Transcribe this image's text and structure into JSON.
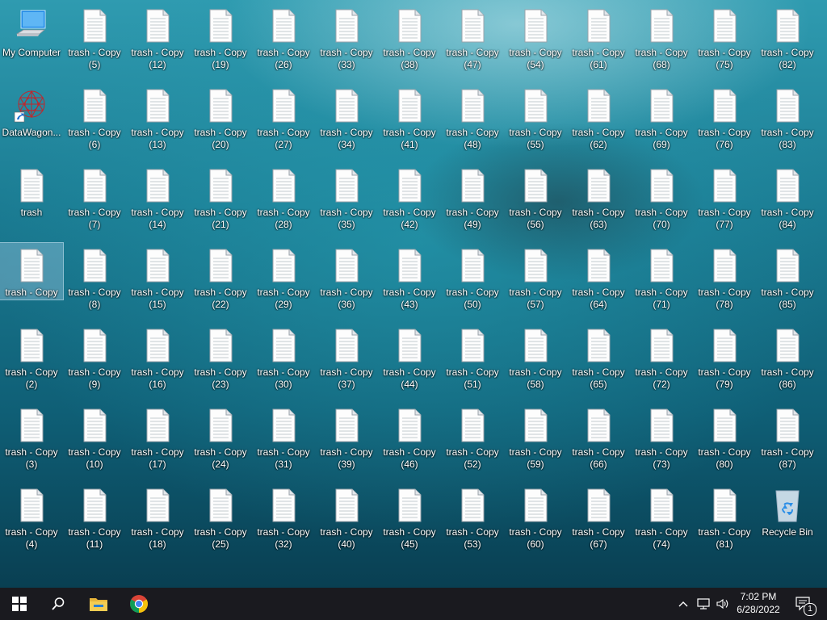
{
  "desktop": {
    "icons": [
      {
        "name": "my-computer-icon",
        "type": "computer",
        "label": "My Computer",
        "sub": "",
        "col": 0,
        "row": 0
      },
      {
        "name": "datawagon-shortcut-icon",
        "type": "app",
        "label": "DataWagon...",
        "sub": "",
        "col": 0,
        "row": 1
      },
      {
        "name": "file-icon",
        "type": "file",
        "label": "trash",
        "sub": "",
        "col": 0,
        "row": 2
      },
      {
        "name": "file-icon",
        "type": "file",
        "label": "trash - Copy",
        "sub": "",
        "col": 0,
        "row": 3,
        "selected": true
      },
      {
        "name": "file-icon",
        "type": "file",
        "label": "trash - Copy",
        "sub": "(2)",
        "col": 0,
        "row": 4
      },
      {
        "name": "file-icon",
        "type": "file",
        "label": "trash - Copy",
        "sub": "(3)",
        "col": 0,
        "row": 5
      },
      {
        "name": "file-icon",
        "type": "file",
        "label": "trash - Copy",
        "sub": "(4)",
        "col": 0,
        "row": 6
      },
      {
        "name": "file-icon",
        "type": "file",
        "label": "trash - Copy",
        "sub": "(5)",
        "col": 1,
        "row": 0
      },
      {
        "name": "file-icon",
        "type": "file",
        "label": "trash - Copy",
        "sub": "(6)",
        "col": 1,
        "row": 1
      },
      {
        "name": "file-icon",
        "type": "file",
        "label": "trash - Copy",
        "sub": "(7)",
        "col": 1,
        "row": 2
      },
      {
        "name": "file-icon",
        "type": "file",
        "label": "trash - Copy",
        "sub": "(8)",
        "col": 1,
        "row": 3
      },
      {
        "name": "file-icon",
        "type": "file",
        "label": "trash - Copy",
        "sub": "(9)",
        "col": 1,
        "row": 4
      },
      {
        "name": "file-icon",
        "type": "file",
        "label": "trash - Copy",
        "sub": "(10)",
        "col": 1,
        "row": 5
      },
      {
        "name": "file-icon",
        "type": "file",
        "label": "trash - Copy",
        "sub": "(11)",
        "col": 1,
        "row": 6
      },
      {
        "name": "file-icon",
        "type": "file",
        "label": "trash - Copy",
        "sub": "(12)",
        "col": 2,
        "row": 0
      },
      {
        "name": "file-icon",
        "type": "file",
        "label": "trash - Copy",
        "sub": "(13)",
        "col": 2,
        "row": 1
      },
      {
        "name": "file-icon",
        "type": "file",
        "label": "trash - Copy",
        "sub": "(14)",
        "col": 2,
        "row": 2
      },
      {
        "name": "file-icon",
        "type": "file",
        "label": "trash - Copy",
        "sub": "(15)",
        "col": 2,
        "row": 3
      },
      {
        "name": "file-icon",
        "type": "file",
        "label": "trash - Copy",
        "sub": "(16)",
        "col": 2,
        "row": 4
      },
      {
        "name": "file-icon",
        "type": "file",
        "label": "trash - Copy",
        "sub": "(17)",
        "col": 2,
        "row": 5
      },
      {
        "name": "file-icon",
        "type": "file",
        "label": "trash - Copy",
        "sub": "(18)",
        "col": 2,
        "row": 6
      },
      {
        "name": "file-icon",
        "type": "file",
        "label": "trash - Copy",
        "sub": "(19)",
        "col": 3,
        "row": 0
      },
      {
        "name": "file-icon",
        "type": "file",
        "label": "trash - Copy",
        "sub": "(20)",
        "col": 3,
        "row": 1
      },
      {
        "name": "file-icon",
        "type": "file",
        "label": "trash - Copy",
        "sub": "(21)",
        "col": 3,
        "row": 2
      },
      {
        "name": "file-icon",
        "type": "file",
        "label": "trash - Copy",
        "sub": "(22)",
        "col": 3,
        "row": 3
      },
      {
        "name": "file-icon",
        "type": "file",
        "label": "trash - Copy",
        "sub": "(23)",
        "col": 3,
        "row": 4
      },
      {
        "name": "file-icon",
        "type": "file",
        "label": "trash - Copy",
        "sub": "(24)",
        "col": 3,
        "row": 5
      },
      {
        "name": "file-icon",
        "type": "file",
        "label": "trash - Copy",
        "sub": "(25)",
        "col": 3,
        "row": 6
      },
      {
        "name": "file-icon",
        "type": "file",
        "label": "trash - Copy",
        "sub": "(26)",
        "col": 4,
        "row": 0
      },
      {
        "name": "file-icon",
        "type": "file",
        "label": "trash - Copy",
        "sub": "(27)",
        "col": 4,
        "row": 1
      },
      {
        "name": "file-icon",
        "type": "file",
        "label": "trash - Copy",
        "sub": "(28)",
        "col": 4,
        "row": 2
      },
      {
        "name": "file-icon",
        "type": "file",
        "label": "trash - Copy",
        "sub": "(29)",
        "col": 4,
        "row": 3
      },
      {
        "name": "file-icon",
        "type": "file",
        "label": "trash - Copy",
        "sub": "(30)",
        "col": 4,
        "row": 4
      },
      {
        "name": "file-icon",
        "type": "file",
        "label": "trash - Copy",
        "sub": "(31)",
        "col": 4,
        "row": 5
      },
      {
        "name": "file-icon",
        "type": "file",
        "label": "trash - Copy",
        "sub": "(32)",
        "col": 4,
        "row": 6
      },
      {
        "name": "file-icon",
        "type": "file",
        "label": "trash - Copy",
        "sub": "(33)",
        "col": 5,
        "row": 0
      },
      {
        "name": "file-icon",
        "type": "file",
        "label": "trash - Copy",
        "sub": "(34)",
        "col": 5,
        "row": 1
      },
      {
        "name": "file-icon",
        "type": "file",
        "label": "trash - Copy",
        "sub": "(35)",
        "col": 5,
        "row": 2
      },
      {
        "name": "file-icon",
        "type": "file",
        "label": "trash - Copy",
        "sub": "(36)",
        "col": 5,
        "row": 3
      },
      {
        "name": "file-icon",
        "type": "file",
        "label": "trash - Copy",
        "sub": "(37)",
        "col": 5,
        "row": 4
      },
      {
        "name": "file-icon",
        "type": "file",
        "label": "trash - Copy",
        "sub": "(39)",
        "col": 5,
        "row": 5
      },
      {
        "name": "file-icon",
        "type": "file",
        "label": "trash - Copy",
        "sub": "(40)",
        "col": 5,
        "row": 6
      },
      {
        "name": "file-icon",
        "type": "file",
        "label": "trash - Copy",
        "sub": "(38)",
        "col": 6,
        "row": 0
      },
      {
        "name": "file-icon",
        "type": "file",
        "label": "trash - Copy",
        "sub": "(41)",
        "col": 6,
        "row": 1
      },
      {
        "name": "file-icon",
        "type": "file",
        "label": "trash - Copy",
        "sub": "(42)",
        "col": 6,
        "row": 2
      },
      {
        "name": "file-icon",
        "type": "file",
        "label": "trash - Copy",
        "sub": "(43)",
        "col": 6,
        "row": 3
      },
      {
        "name": "file-icon",
        "type": "file",
        "label": "trash - Copy",
        "sub": "(44)",
        "col": 6,
        "row": 4
      },
      {
        "name": "file-icon",
        "type": "file",
        "label": "trash - Copy",
        "sub": "(46)",
        "col": 6,
        "row": 5
      },
      {
        "name": "file-icon",
        "type": "file",
        "label": "trash - Copy",
        "sub": "(45)",
        "col": 6,
        "row": 6
      },
      {
        "name": "file-icon",
        "type": "file",
        "label": "trash - Copy",
        "sub": "(47)",
        "col": 7,
        "row": 0
      },
      {
        "name": "file-icon",
        "type": "file",
        "label": "trash - Copy",
        "sub": "(48)",
        "col": 7,
        "row": 1
      },
      {
        "name": "file-icon",
        "type": "file",
        "label": "trash - Copy",
        "sub": "(49)",
        "col": 7,
        "row": 2
      },
      {
        "name": "file-icon",
        "type": "file",
        "label": "trash - Copy",
        "sub": "(50)",
        "col": 7,
        "row": 3
      },
      {
        "name": "file-icon",
        "type": "file",
        "label": "trash - Copy",
        "sub": "(51)",
        "col": 7,
        "row": 4
      },
      {
        "name": "file-icon",
        "type": "file",
        "label": "trash - Copy",
        "sub": "(52)",
        "col": 7,
        "row": 5
      },
      {
        "name": "file-icon",
        "type": "file",
        "label": "trash - Copy",
        "sub": "(53)",
        "col": 7,
        "row": 6
      },
      {
        "name": "file-icon",
        "type": "file",
        "label": "trash - Copy",
        "sub": "(54)",
        "col": 8,
        "row": 0
      },
      {
        "name": "file-icon",
        "type": "file",
        "label": "trash - Copy",
        "sub": "(55)",
        "col": 8,
        "row": 1
      },
      {
        "name": "file-icon",
        "type": "file",
        "label": "trash - Copy",
        "sub": "(56)",
        "col": 8,
        "row": 2
      },
      {
        "name": "file-icon",
        "type": "file",
        "label": "trash - Copy",
        "sub": "(57)",
        "col": 8,
        "row": 3
      },
      {
        "name": "file-icon",
        "type": "file",
        "label": "trash - Copy",
        "sub": "(58)",
        "col": 8,
        "row": 4
      },
      {
        "name": "file-icon",
        "type": "file",
        "label": "trash - Copy",
        "sub": "(59)",
        "col": 8,
        "row": 5
      },
      {
        "name": "file-icon",
        "type": "file",
        "label": "trash - Copy",
        "sub": "(60)",
        "col": 8,
        "row": 6
      },
      {
        "name": "file-icon",
        "type": "file",
        "label": "trash - Copy",
        "sub": "(61)",
        "col": 9,
        "row": 0
      },
      {
        "name": "file-icon",
        "type": "file",
        "label": "trash - Copy",
        "sub": "(62)",
        "col": 9,
        "row": 1
      },
      {
        "name": "file-icon",
        "type": "file",
        "label": "trash - Copy",
        "sub": "(63)",
        "col": 9,
        "row": 2
      },
      {
        "name": "file-icon",
        "type": "file",
        "label": "trash - Copy",
        "sub": "(64)",
        "col": 9,
        "row": 3
      },
      {
        "name": "file-icon",
        "type": "file",
        "label": "trash - Copy",
        "sub": "(65)",
        "col": 9,
        "row": 4
      },
      {
        "name": "file-icon",
        "type": "file",
        "label": "trash - Copy",
        "sub": "(66)",
        "col": 9,
        "row": 5
      },
      {
        "name": "file-icon",
        "type": "file",
        "label": "trash - Copy",
        "sub": "(67)",
        "col": 9,
        "row": 6
      },
      {
        "name": "file-icon",
        "type": "file",
        "label": "trash - Copy",
        "sub": "(68)",
        "col": 10,
        "row": 0
      },
      {
        "name": "file-icon",
        "type": "file",
        "label": "trash - Copy",
        "sub": "(69)",
        "col": 10,
        "row": 1
      },
      {
        "name": "file-icon",
        "type": "file",
        "label": "trash - Copy",
        "sub": "(70)",
        "col": 10,
        "row": 2
      },
      {
        "name": "file-icon",
        "type": "file",
        "label": "trash - Copy",
        "sub": "(71)",
        "col": 10,
        "row": 3
      },
      {
        "name": "file-icon",
        "type": "file",
        "label": "trash - Copy",
        "sub": "(72)",
        "col": 10,
        "row": 4
      },
      {
        "name": "file-icon",
        "type": "file",
        "label": "trash - Copy",
        "sub": "(73)",
        "col": 10,
        "row": 5
      },
      {
        "name": "file-icon",
        "type": "file",
        "label": "trash - Copy",
        "sub": "(74)",
        "col": 10,
        "row": 6
      },
      {
        "name": "file-icon",
        "type": "file",
        "label": "trash - Copy",
        "sub": "(75)",
        "col": 11,
        "row": 0
      },
      {
        "name": "file-icon",
        "type": "file",
        "label": "trash - Copy",
        "sub": "(76)",
        "col": 11,
        "row": 1
      },
      {
        "name": "file-icon",
        "type": "file",
        "label": "trash - Copy",
        "sub": "(77)",
        "col": 11,
        "row": 2
      },
      {
        "name": "file-icon",
        "type": "file",
        "label": "trash - Copy",
        "sub": "(78)",
        "col": 11,
        "row": 3
      },
      {
        "name": "file-icon",
        "type": "file",
        "label": "trash - Copy",
        "sub": "(79)",
        "col": 11,
        "row": 4
      },
      {
        "name": "file-icon",
        "type": "file",
        "label": "trash - Copy",
        "sub": "(80)",
        "col": 11,
        "row": 5
      },
      {
        "name": "file-icon",
        "type": "file",
        "label": "trash - Copy",
        "sub": "(81)",
        "col": 11,
        "row": 6
      },
      {
        "name": "file-icon",
        "type": "file",
        "label": "trash - Copy",
        "sub": "(82)",
        "col": 12,
        "row": 0
      },
      {
        "name": "file-icon",
        "type": "file",
        "label": "trash - Copy",
        "sub": "(83)",
        "col": 12,
        "row": 1
      },
      {
        "name": "file-icon",
        "type": "file",
        "label": "trash - Copy",
        "sub": "(84)",
        "col": 12,
        "row": 2
      },
      {
        "name": "file-icon",
        "type": "file",
        "label": "trash - Copy",
        "sub": "(85)",
        "col": 12,
        "row": 3
      },
      {
        "name": "file-icon",
        "type": "file",
        "label": "trash - Copy",
        "sub": "(86)",
        "col": 12,
        "row": 4
      },
      {
        "name": "file-icon",
        "type": "file",
        "label": "trash - Copy",
        "sub": "(87)",
        "col": 12,
        "row": 5
      },
      {
        "name": "recycle-bin-icon",
        "type": "recycle",
        "label": "Recycle Bin",
        "sub": "",
        "col": 12,
        "row": 6
      }
    ]
  },
  "taskbar": {
    "start_icon": "windows-logo-icon",
    "search_icon": "search-icon",
    "pinned": [
      {
        "name": "file-explorer-icon"
      },
      {
        "name": "chrome-icon"
      }
    ],
    "tray": {
      "chevron_icon": "chevron-up-icon",
      "network_icon": "network-icon",
      "volume_icon": "volume-icon",
      "notification_icon": "notification-icon",
      "notification_count": "1"
    },
    "clock": {
      "time": "7:02 PM",
      "date": "6/28/2022"
    }
  },
  "colors": {
    "taskbar": "#1a1a1f",
    "accent_windows": "#3a9bdc",
    "ocean_light": "#2f9bb0",
    "ocean_dark": "#093f52"
  }
}
